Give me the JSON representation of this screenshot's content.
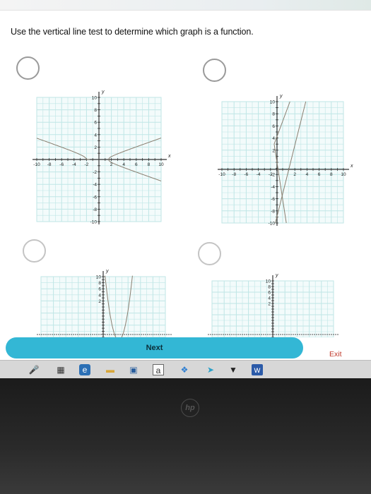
{
  "question": {
    "text": "Use the vertical line test to determine which graph is a function."
  },
  "graphs": [
    {
      "x_ticks": [
        "-10",
        "-8",
        "-6",
        "-4",
        "-2",
        "2",
        "4",
        "6",
        "8",
        "10"
      ],
      "y_ticks": [
        "10",
        "8",
        "6",
        "4",
        "2",
        "-2",
        "-4",
        "-6",
        "-8",
        "-10"
      ],
      "x_label": "x",
      "y_label": "y"
    },
    {
      "x_ticks": [
        "-10",
        "-8",
        "-6",
        "-4",
        "-2",
        "2",
        "4",
        "6",
        "8",
        "10"
      ],
      "y_ticks": [
        "10",
        "8",
        "6",
        "4",
        "2",
        "-2",
        "-4",
        "-6",
        "-8",
        "-10"
      ],
      "x_label": "x",
      "y_label": "y"
    },
    {
      "y_ticks": [
        "10",
        "8",
        "6",
        "4",
        "2"
      ],
      "y_label": "y"
    },
    {
      "y_ticks": [
        "10",
        "8",
        "6",
        "4",
        "2"
      ],
      "y_label": "y"
    }
  ],
  "footer": {
    "next_label": "Next",
    "exit_label": "Exit"
  },
  "taskbar": {
    "word_label": "a"
  },
  "colors": {
    "accent": "#33b7d5",
    "grid": "#bfe6e6",
    "curve": "#8a7f70",
    "exit": "#c0392b"
  },
  "icons": [
    "mic-icon",
    "task-view-icon",
    "edge-icon",
    "file-explorer-icon",
    "store-icon",
    "word-icon",
    "dropbox-icon",
    "arrow-icon",
    "email-icon",
    "app-icon"
  ]
}
